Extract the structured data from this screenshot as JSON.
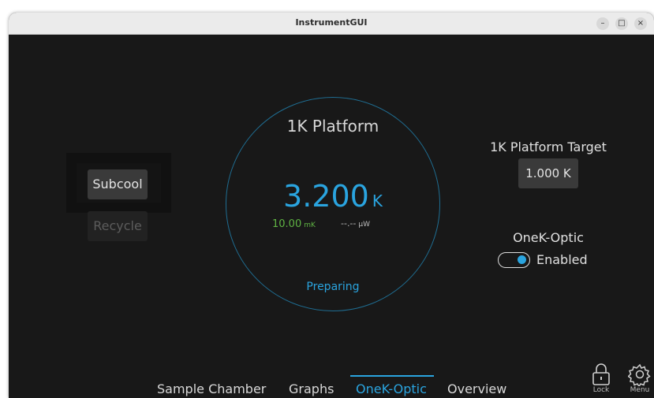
{
  "window": {
    "title": "InstrumentGUI",
    "controls": {
      "minimize": "–",
      "maximize": "□",
      "close": "×"
    }
  },
  "left_buttons": {
    "subcool": "Subcool",
    "recycle": "Recycle"
  },
  "gauge": {
    "label": "1K Platform",
    "temperature": "3.200",
    "temperature_unit": "K",
    "stability": "10.00",
    "stability_unit": "mK",
    "power": "--.--",
    "power_unit": "µW",
    "status": "Preparing"
  },
  "target": {
    "label": "1K Platform Target",
    "value": "1.000 K"
  },
  "onek_optic": {
    "label": "OneK-Optic",
    "toggle_state": "Enabled",
    "enabled": true
  },
  "tabs": [
    {
      "label": "Sample Chamber",
      "active": false
    },
    {
      "label": "Graphs",
      "active": false
    },
    {
      "label": "OneK-Optic",
      "active": true
    },
    {
      "label": "Overview",
      "active": false
    }
  ],
  "corner": {
    "lock": "Lock",
    "menu": "Menu"
  },
  "colors": {
    "accent": "#2aa4df",
    "stability_green": "#5fb343",
    "background": "#181818",
    "gauge_ring": "#1f6e93"
  },
  "icons": [
    "lock-icon",
    "gear-icon",
    "minimize-icon",
    "maximize-icon",
    "close-icon"
  ]
}
